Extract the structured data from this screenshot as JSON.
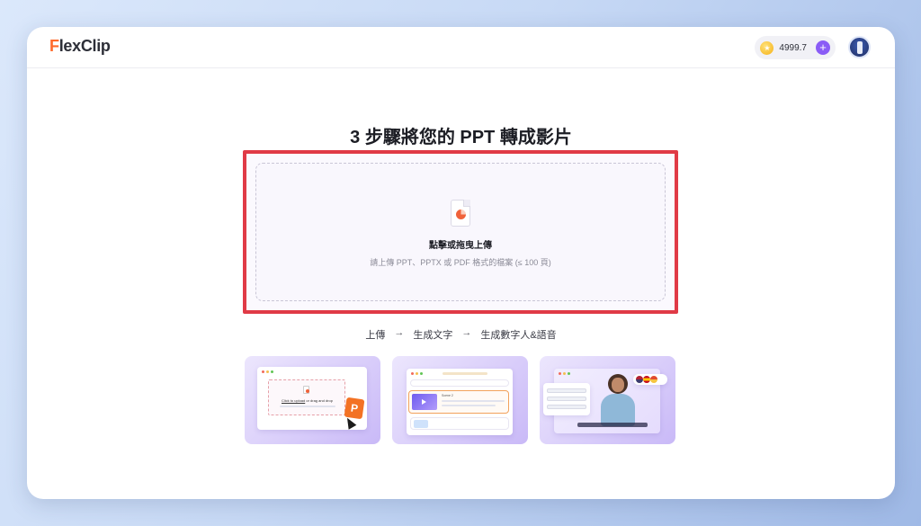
{
  "app": {
    "logo_f": "F",
    "logo_rest": "lexClip"
  },
  "header": {
    "credits": "4999.7",
    "plus_label": "+"
  },
  "main": {
    "title": "3 步驟將您的 PPT 轉成影片",
    "upload": {
      "label": "點擊或拖曳上傳",
      "hint": "請上傳 PPT、PPTX 或 PDF 格式的檔案 (≤ 100 頁)"
    },
    "steps": [
      "上傳",
      "生成文字",
      "生成數字人&語音"
    ],
    "arrow": "→"
  },
  "cards": {
    "card1": {
      "click_text": "Click to upload",
      "drag_text": " or drag and drop",
      "p_badge": "P"
    },
    "card2": {
      "scene_label": "Scene 2"
    },
    "card3": {}
  },
  "colors": {
    "accent": "#8a5cf6",
    "highlight_border": "#e03a46",
    "logo_orange": "#ff6a2b"
  }
}
